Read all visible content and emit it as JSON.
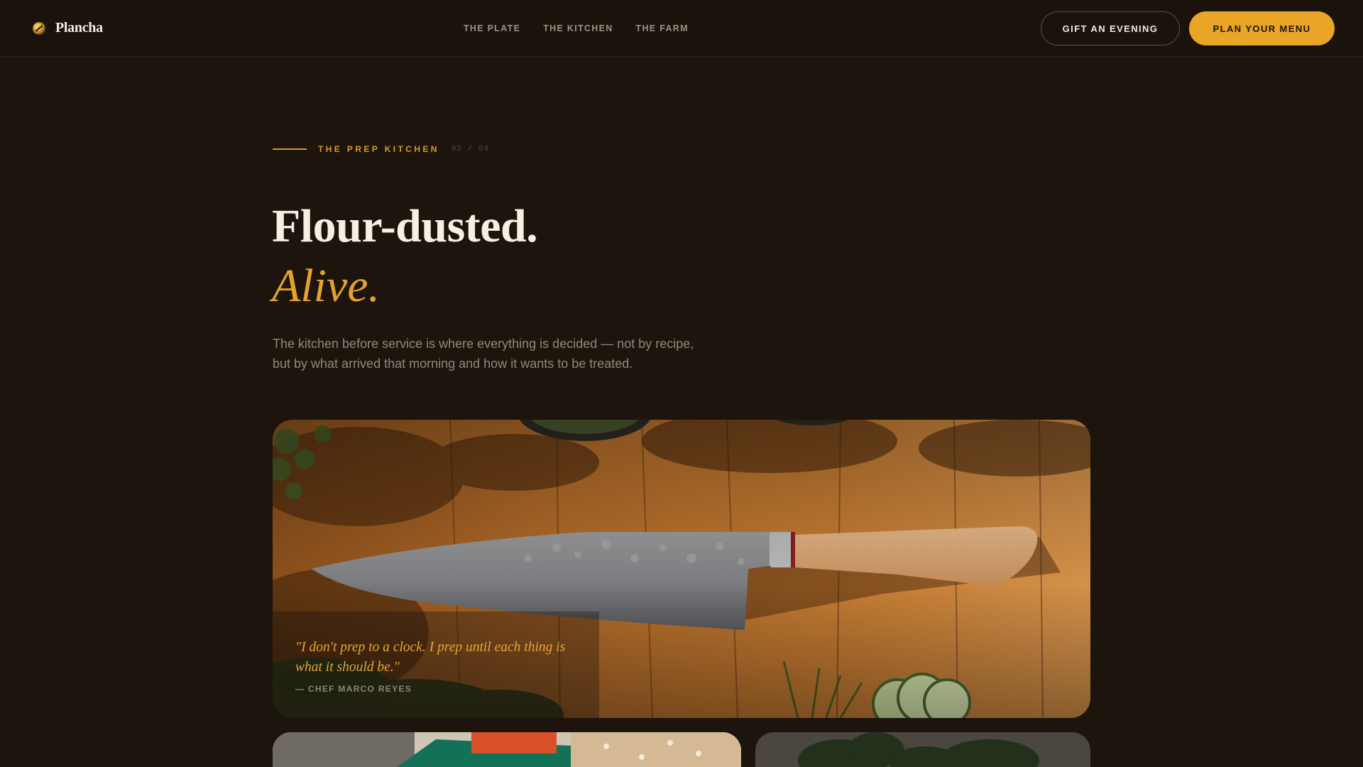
{
  "header": {
    "brand": "Plancha",
    "nav": [
      "THE PLATE",
      "THE KITCHEN",
      "THE FARM"
    ],
    "gift_label": "GIFT AN EVENING",
    "plan_label": "PLAN YOUR MENU"
  },
  "hero": {
    "eyebrow": "THE PREP KITCHEN",
    "counter": "02 / 04",
    "headline": "Flour-dusted.",
    "headline_accent": "Alive.",
    "lede": "The kitchen before service is where everything is decided — not by recipe, but by what arrived that morning and how it wants to be treated."
  },
  "feature": {
    "quote": "\"I don't prep to a clock. I prep until each thing is what it should be.\"",
    "attribution": "— CHEF MARCO REYES"
  },
  "colors": {
    "background": "#1c140d",
    "accent": "#e9a525",
    "text": "#f6efe2"
  },
  "icons": [
    "logo-mark-icon"
  ]
}
